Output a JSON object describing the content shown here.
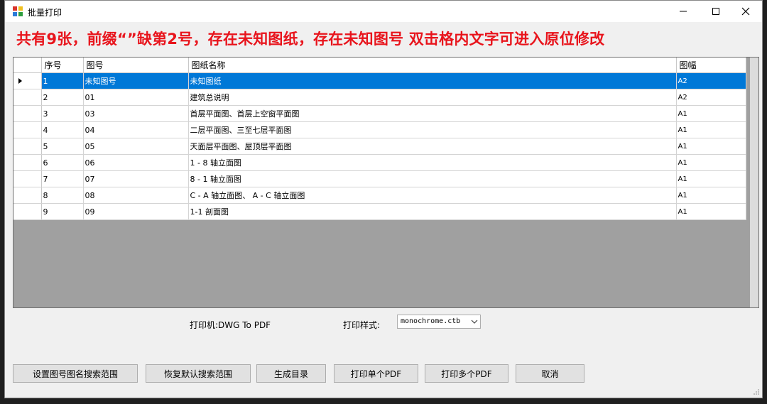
{
  "window": {
    "title": "批量打印"
  },
  "headline": "共有9张，前缀“”缺第2号，存在未知图纸，存在未知图号 双击格内文字可进入原位修改",
  "table": {
    "columns": [
      "序号",
      "图号",
      "图纸名称",
      "图幅"
    ],
    "rows": [
      [
        "1",
        "未知图号",
        "未知图纸",
        "A2"
      ],
      [
        "2",
        "01",
        "建筑总说明",
        "A2"
      ],
      [
        "3",
        "03",
        "首层平面图、首层上空窗平面图",
        "A1"
      ],
      [
        "4",
        "04",
        "二层平面图、三至七层平面图",
        "A1"
      ],
      [
        "5",
        "05",
        "天面层平面图、屋顶层平面图",
        "A1"
      ],
      [
        "6",
        "06",
        "1 - 8 轴立面图",
        "A1"
      ],
      [
        "7",
        "07",
        "8 - 1 轴立面图",
        "A1"
      ],
      [
        "8",
        "08",
        "C - A 轴立面图、 A - C 轴立面图",
        "A1"
      ],
      [
        "9",
        "09",
        "1-1 剖面图",
        "A1"
      ]
    ],
    "selected_row": 0
  },
  "printer": {
    "label": "打印机:DWG To PDF"
  },
  "style": {
    "label": "打印样式:",
    "selected": "monochrome.ctb"
  },
  "buttons": {
    "set_range": "设置图号图名搜索范围",
    "restore_range": "恢复默认搜索范围",
    "gen_toc": "生成目录",
    "print_single": "打印单个PDF",
    "print_multi": "打印多个PDF",
    "cancel": "取消"
  },
  "colors": {
    "headline": "#e8141c",
    "selection": "#0078d7"
  },
  "icons": [
    "app-icon",
    "minimize-icon",
    "maximize-icon",
    "close-icon",
    "row-pointer-icon",
    "chevron-down-icon",
    "resize-grip-icon"
  ]
}
